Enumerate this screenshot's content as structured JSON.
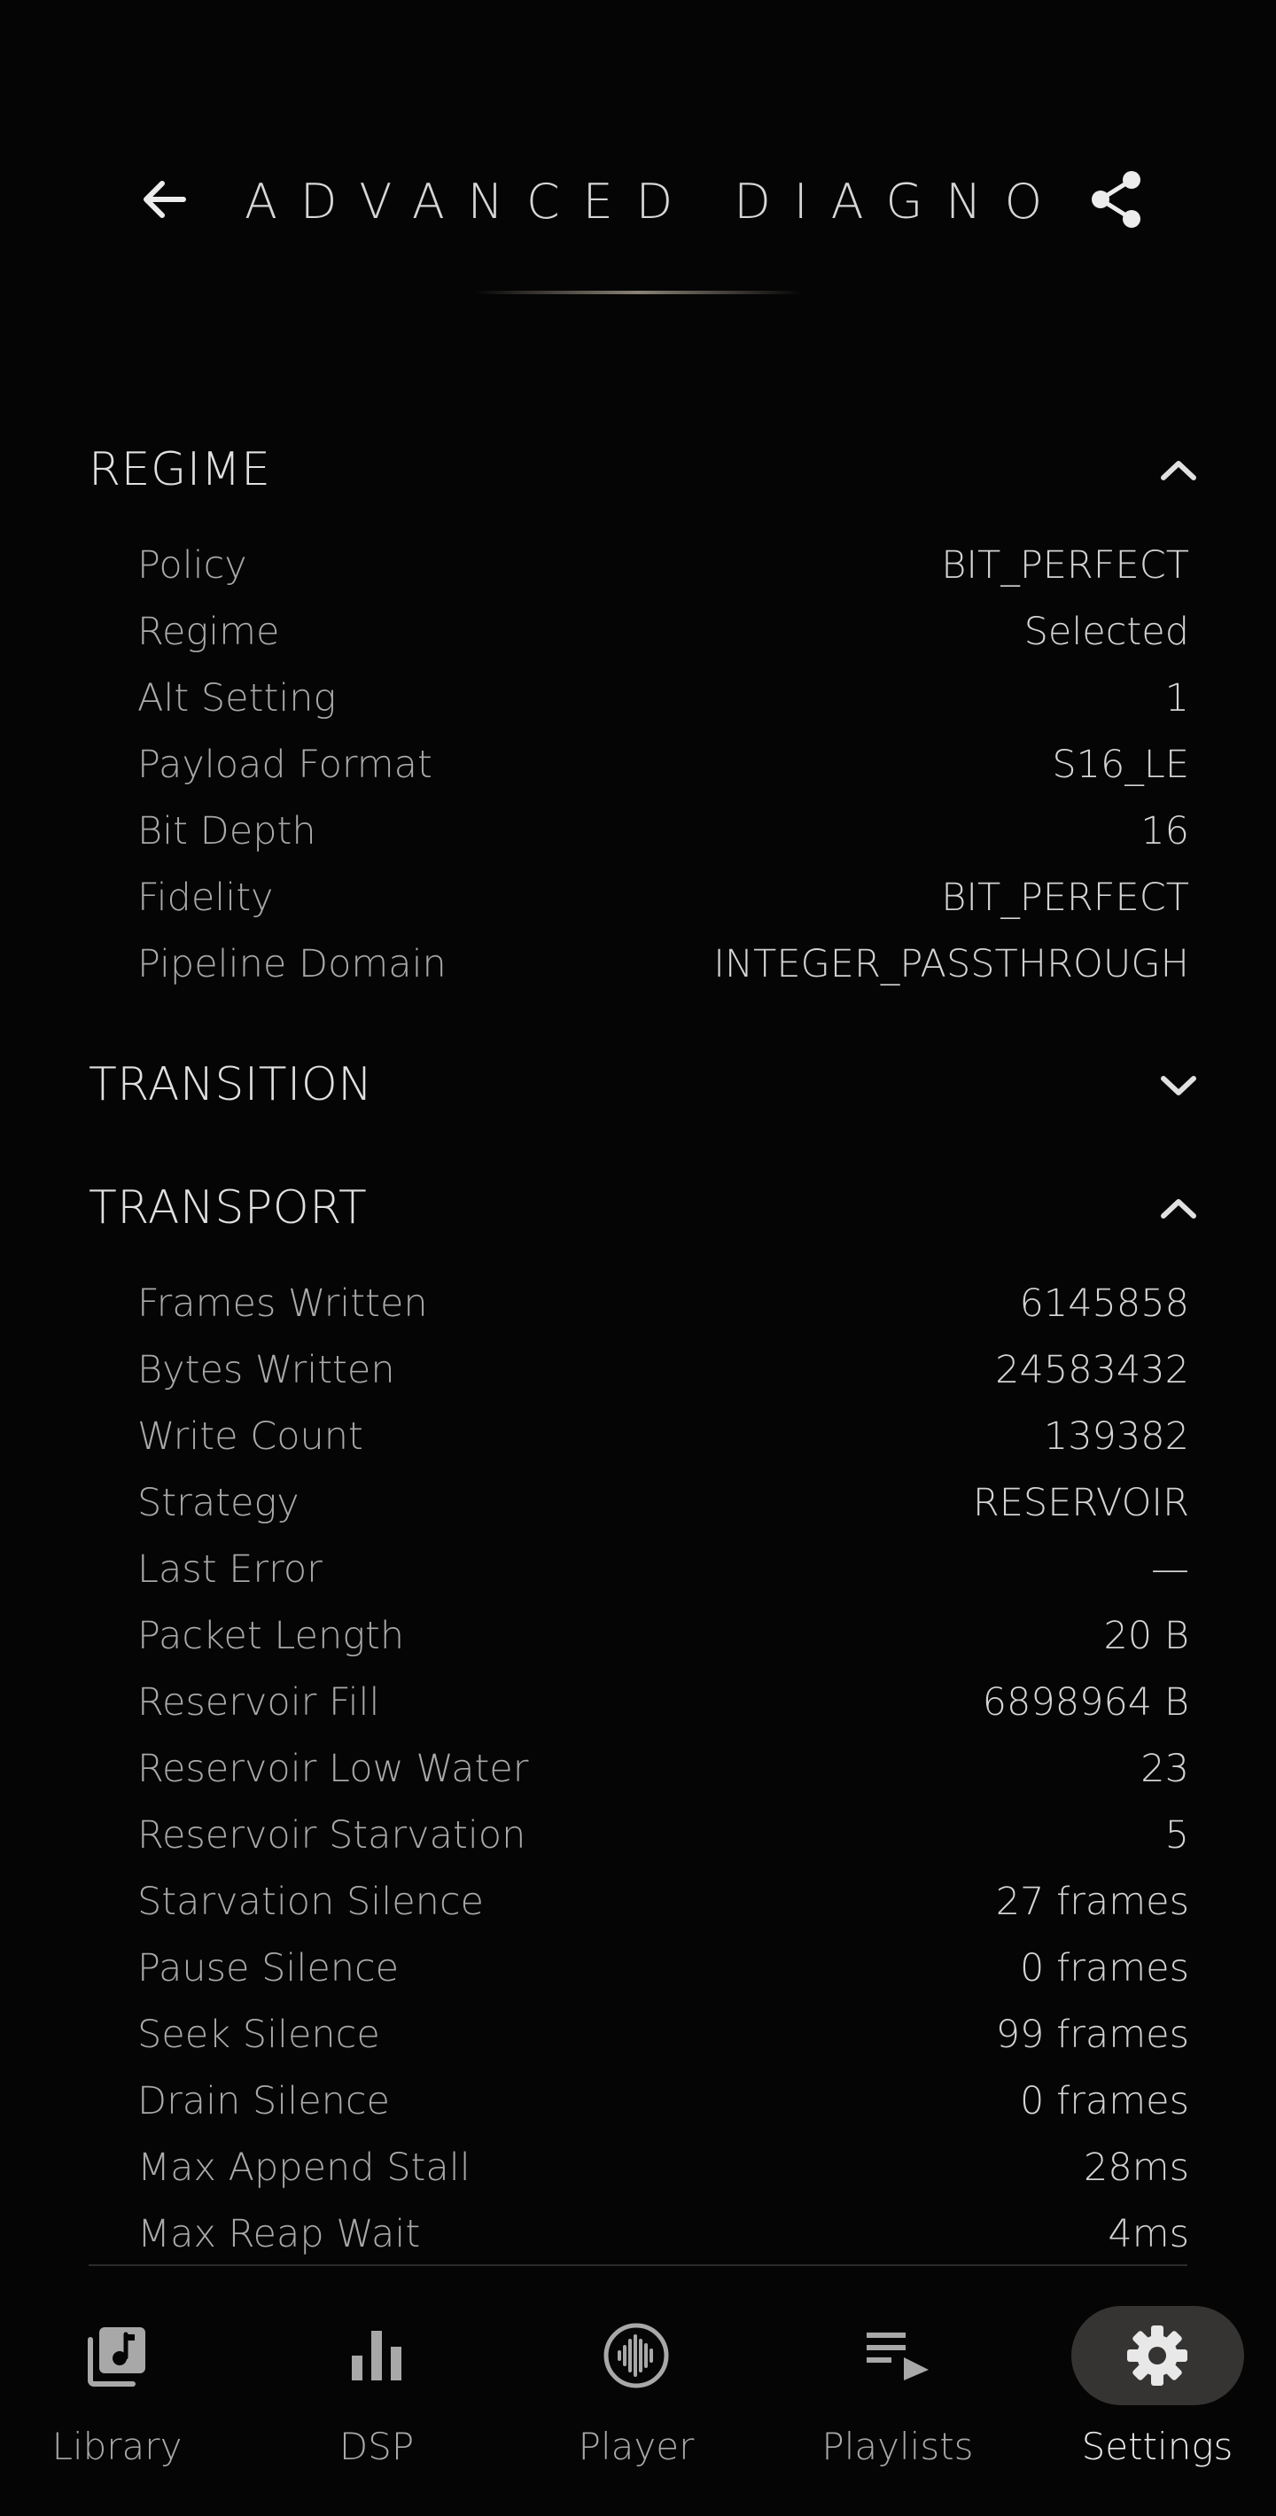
{
  "header": {
    "title": "ADVANCED DIAGNOSTICS",
    "back_icon": "arrow-left-icon",
    "share_icon": "share-icon"
  },
  "sections": {
    "regime": {
      "title": "REGIME",
      "expanded": true,
      "rows": [
        {
          "label": "Policy",
          "value": "BIT_PERFECT"
        },
        {
          "label": "Regime",
          "value": "Selected"
        },
        {
          "label": "Alt Setting",
          "value": "1"
        },
        {
          "label": "Payload Format",
          "value": "S16_LE"
        },
        {
          "label": "Bit Depth",
          "value": "16"
        },
        {
          "label": "Fidelity",
          "value": "BIT_PERFECT"
        },
        {
          "label": "Pipeline Domain",
          "value": "INTEGER_PASSTHROUGH"
        }
      ]
    },
    "transition": {
      "title": "TRANSITION",
      "expanded": false
    },
    "transport": {
      "title": "TRANSPORT",
      "expanded": true,
      "rows": [
        {
          "label": "Frames Written",
          "value": "6145858"
        },
        {
          "label": "Bytes Written",
          "value": "24583432"
        },
        {
          "label": "Write Count",
          "value": "139382"
        },
        {
          "label": "Strategy",
          "value": "RESERVOIR"
        },
        {
          "label": "Last Error",
          "value": "—"
        },
        {
          "label": "Packet Length",
          "value": "20 B"
        },
        {
          "label": "Reservoir Fill",
          "value": "6898964 B"
        },
        {
          "label": "Reservoir Low Water",
          "value": "23"
        },
        {
          "label": "Reservoir Starvation",
          "value": "5"
        },
        {
          "label": "Starvation Silence",
          "value": "27 frames"
        },
        {
          "label": "Pause Silence",
          "value": "0 frames"
        },
        {
          "label": "Seek Silence",
          "value": "99 frames"
        },
        {
          "label": "Drain Silence",
          "value": "0 frames"
        },
        {
          "label": "Max Append Stall",
          "value": "28ms"
        },
        {
          "label": "Max Reap Wait",
          "value": "4ms"
        }
      ]
    }
  },
  "nav": {
    "items": [
      {
        "label": "Library",
        "icon": "music-library-icon"
      },
      {
        "label": "DSP",
        "icon": "bar-chart-icon"
      },
      {
        "label": "Player",
        "icon": "waveform-circle-icon"
      },
      {
        "label": "Playlists",
        "icon": "playlist-play-icon"
      },
      {
        "label": "Settings",
        "icon": "gear-icon"
      }
    ],
    "active": "Settings"
  },
  "colors": {
    "background": "#050505",
    "text": "#e6e6e6",
    "muted": "#a9a9a9",
    "active_pill": "#363432"
  }
}
